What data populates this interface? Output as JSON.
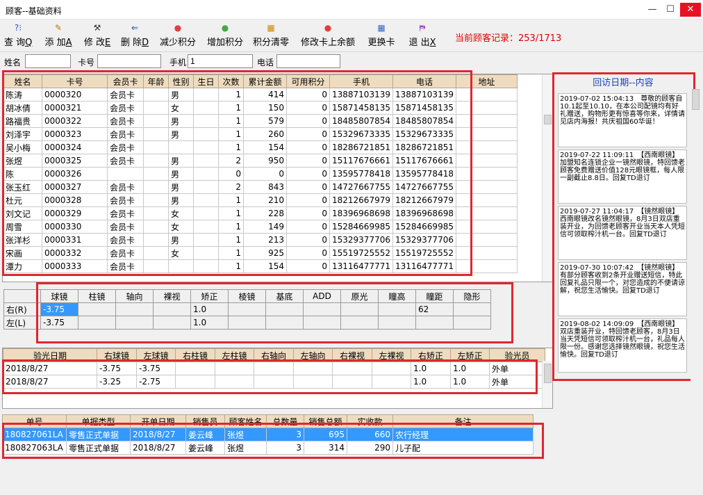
{
  "window": {
    "title": "顾客--基础资料",
    "minimize": "—",
    "maximize": "☐",
    "close": "✕"
  },
  "toolbar": [
    {
      "icon": "?⁝",
      "label": "查 询",
      "key": "Q"
    },
    {
      "icon": "✎",
      "label": "添 加",
      "key": "A"
    },
    {
      "icon": "⚒",
      "label": "修 改",
      "key": "E"
    },
    {
      "icon": "⇐",
      "label": "删 除",
      "key": "D"
    },
    {
      "icon": "●",
      "label": "减少积分",
      "key": ""
    },
    {
      "icon": "●",
      "label": "增加积分",
      "key": ""
    },
    {
      "icon": "▦",
      "label": "积分清零",
      "key": ""
    },
    {
      "icon": "●",
      "label": "修改卡上余额",
      "key": ""
    },
    {
      "icon": "▦",
      "label": "更换卡",
      "key": ""
    },
    {
      "icon": "⛿",
      "label": "退 出",
      "key": "X"
    }
  ],
  "record_text": "当前顾客记录：253/1713",
  "filter": {
    "name_label": "姓名",
    "name_value": "",
    "card_label": "卡号",
    "card_value": "",
    "mobile_label": "手机",
    "mobile_value": "1",
    "phone_label": "电话",
    "phone_value": ""
  },
  "customers": {
    "headers": [
      "姓名",
      "卡号",
      "会员卡",
      "年龄",
      "性别",
      "生日",
      "次数",
      "累计金额",
      "可用积分",
      "手机",
      "电话",
      "地址"
    ],
    "rows": [
      [
        "陈涛",
        "0000320",
        "会员卡",
        "",
        "男",
        "",
        "1",
        "414",
        "0",
        "13887103139",
        "13887103139",
        ""
      ],
      [
        "胡冰倩",
        "0000321",
        "会员卡",
        "",
        "女",
        "",
        "1",
        "150",
        "0",
        "15871458135",
        "15871458135",
        ""
      ],
      [
        "路福贵",
        "0000322",
        "会员卡",
        "",
        "男",
        "",
        "1",
        "579",
        "0",
        "18485807854",
        "18485807854",
        ""
      ],
      [
        "刘泽宇",
        "0000323",
        "会员卡",
        "",
        "男",
        "",
        "1",
        "260",
        "0",
        "15329673335",
        "15329673335",
        ""
      ],
      [
        "吴小梅",
        "0000324",
        "会员卡",
        "",
        "",
        "",
        "1",
        "154",
        "0",
        "18286721851",
        "18286721851",
        ""
      ],
      [
        "张煜",
        "0000325",
        "会员卡",
        "",
        "男",
        "",
        "2",
        "950",
        "0",
        "15117676661",
        "15117676661",
        ""
      ],
      [
        "陈",
        "0000326",
        "",
        "",
        "男",
        "",
        "0",
        "0",
        "0",
        "13595778418",
        "13595778418",
        ""
      ],
      [
        "张玉红",
        "0000327",
        "会员卡",
        "",
        "男",
        "",
        "2",
        "843",
        "0",
        "14727667755",
        "14727667755",
        ""
      ],
      [
        "杜元",
        "0000328",
        "会员卡",
        "",
        "男",
        "",
        "1",
        "210",
        "0",
        "18212667979",
        "18212667979",
        ""
      ],
      [
        "刘文记",
        "0000329",
        "会员卡",
        "",
        "女",
        "",
        "1",
        "228",
        "0",
        "18396968698",
        "18396968698",
        ""
      ],
      [
        "周雪",
        "0000330",
        "会员卡",
        "",
        "女",
        "",
        "1",
        "149",
        "0",
        "15284669985",
        "15284669985",
        ""
      ],
      [
        "张洋杉",
        "0000331",
        "会员卡",
        "",
        "男",
        "",
        "1",
        "213",
        "0",
        "15329377706",
        "15329377706",
        ""
      ],
      [
        "宋画",
        "0000332",
        "会员卡",
        "",
        "女",
        "",
        "1",
        "925",
        "0",
        "15519725552",
        "15519725552",
        ""
      ],
      [
        "潭力",
        "0000333",
        "会员卡",
        "",
        "",
        "",
        "1",
        "154",
        "0",
        "13116477771",
        "13116477771",
        ""
      ]
    ]
  },
  "vision": {
    "headers": [
      "",
      "球镜",
      "柱镜",
      "轴向",
      "裸视",
      "矫正",
      "棱镜",
      "基底",
      "ADD",
      "原光",
      "瞳高",
      "瞳距",
      "隐形"
    ],
    "rows": [
      [
        "右(R)",
        "-3.75",
        "",
        "",
        "",
        "1.0",
        "",
        "",
        "",
        "",
        "",
        "62",
        ""
      ],
      [
        "左(L)",
        "-3.75",
        "",
        "",
        "",
        "1.0",
        "",
        "",
        "",
        "",
        "",
        "",
        ""
      ]
    ]
  },
  "optometry": {
    "headers": [
      "验光日期",
      "右球镜",
      "左球镜",
      "右柱镜",
      "左柱镜",
      "右轴向",
      "左轴向",
      "右裸视",
      "左裸视",
      "右矫正",
      "左矫正",
      "验光员"
    ],
    "rows": [
      [
        "2018/8/27",
        "-3.75",
        "-3.75",
        "",
        "",
        "",
        "",
        "",
        "",
        "1.0",
        "1.0",
        "外单"
      ],
      [
        "2018/8/27",
        "-3.25",
        "-2.75",
        "",
        "",
        "",
        "",
        "",
        "",
        "1.0",
        "1.0",
        "外单"
      ]
    ]
  },
  "orders": {
    "headers": [
      "单号",
      "单据类型",
      "开单日期",
      "销售员",
      "顾客姓名",
      "总数量",
      "销售总额",
      "实收款",
      "备注"
    ],
    "rows": [
      [
        "180827061LA",
        "零售正式单据",
        "2018/8/27",
        "姜云峰",
        "张煜",
        "3",
        "695",
        "660",
        "农行经理"
      ],
      [
        "180827063LA",
        "零售正式单据",
        "2018/8/27",
        "姜云峰",
        "张煜",
        "3",
        "314",
        "290",
        "儿子配"
      ]
    ]
  },
  "followup": {
    "title": "回访日期--内容",
    "notes": [
      "2019-07-02 15:04:13　尊敬的顾客自10.1起至10.10，在本公司配镜均有好礼赠送，购物形更有惊喜等你来，详情请见店内海报！共庆祖国60华诞！",
      "2019-07-22 11:09:11　【西南眼镜】加盟知名连锁企业一镜然眼镜，特回馈老顾客免费赠送价值128元眼镜框，每人限一副截止8.8日。回复TD退订",
      "2019-07-27 11:04:17　【镜然眼镜】西南眼镜改名镜然眼镜，8月3日双店重装开业，为回馈老顾客开业当天本人凭短信可领取榨汁机一台。回复TD退订",
      "2019-07-30 10:07:42　【镜然眼镜】有部分顾客收到2条开业赠送短信，特此回复礼品只限一个，对您造成的不便请谅解，祝您生活愉快。回复TD退订",
      "2019-08-02 14:09:09　【西南眼镜】双店重装开业，特回馈老顾客，8月3日当天凭短信可领取榨汁机一台，礼品每人限一份。感谢您选择镜然眼镜，祝您生活愉快。回复TD退订"
    ]
  }
}
